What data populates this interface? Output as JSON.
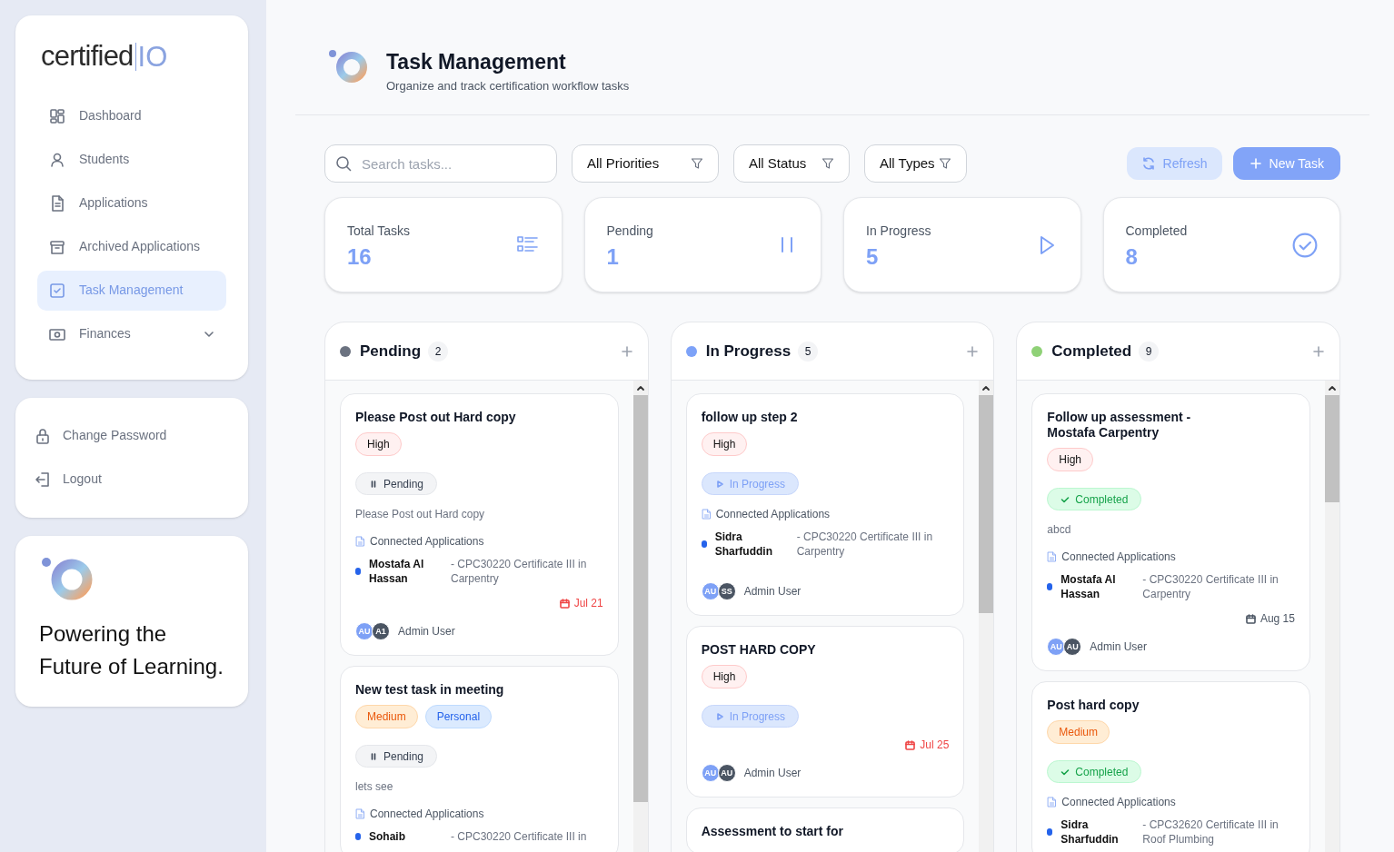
{
  "sidebar": {
    "logo": "certified",
    "logo_suffix": "IO",
    "nav": [
      {
        "label": "Dashboard",
        "selected": false
      },
      {
        "label": "Students",
        "selected": false
      },
      {
        "label": "Applications",
        "selected": false
      },
      {
        "label": "Archived Applications",
        "selected": false
      },
      {
        "label": "Task Management",
        "selected": true
      },
      {
        "label": "Finances",
        "selected": false,
        "expandable": true
      }
    ],
    "account": [
      {
        "label": "Change Password"
      },
      {
        "label": "Logout"
      }
    ],
    "tagline": "Powering the Future of Learning."
  },
  "header": {
    "title": "Task Management",
    "subtitle": "Organize and track certification workflow tasks"
  },
  "toolbar": {
    "search": {
      "placeholder": "Search tasks..."
    },
    "filters": [
      "All Priorities",
      "All Status",
      "All Types"
    ],
    "refresh": "Refresh",
    "new_task": "New Task"
  },
  "stats": [
    {
      "label": "Total Tasks",
      "value": "16"
    },
    {
      "label": "Pending",
      "value": "1"
    },
    {
      "label": "In Progress",
      "value": "5"
    },
    {
      "label": "Completed",
      "value": "8"
    }
  ],
  "columns": [
    {
      "title": "Pending",
      "count": "2",
      "color": "#6b7280",
      "cards": [
        {
          "title": "Please Post out Hard copy",
          "tags": [
            {
              "label": "High",
              "kind": "high"
            }
          ],
          "status": {
            "label": "Pending",
            "kind": "pending"
          },
          "description": "Please Post out Hard copy",
          "apps_label": "Connected Applications",
          "apps": [
            {
              "student": "Mostafa Al Hassan",
              "course": "- CPC30220 Certificate III in Carpentry"
            }
          ],
          "due": {
            "text": "Jul 21",
            "overdue": true
          },
          "avatars": [
            "AU",
            "A1"
          ],
          "assignee": "Admin User"
        },
        {
          "title": "New test task in meeting",
          "tags": [
            {
              "label": "Medium",
              "kind": "medium"
            },
            {
              "label": "Personal",
              "kind": "type"
            }
          ],
          "status": {
            "label": "Pending",
            "kind": "pending"
          },
          "description": "lets see",
          "apps_label": "Connected Applications",
          "apps": [
            {
              "student": "Sohaib",
              "course": "- CPC30220 Certificate III in"
            }
          ]
        }
      ]
    },
    {
      "title": "In Progress",
      "count": "5",
      "color": "#7da2f8",
      "cards": [
        {
          "title": "follow up step 2",
          "tags": [
            {
              "label": "High",
              "kind": "high"
            }
          ],
          "status": {
            "label": "In Progress",
            "kind": "progress"
          },
          "apps_label": "Connected Applications",
          "apps": [
            {
              "student": "Sidra Sharfuddin",
              "course": "- CPC30220 Certificate III in Carpentry"
            }
          ],
          "avatars": [
            "AU",
            "SS"
          ],
          "assignee": "Admin User"
        },
        {
          "title": "POST HARD COPY",
          "tags": [
            {
              "label": "High",
              "kind": "high"
            }
          ],
          "status": {
            "label": "In Progress",
            "kind": "progress"
          },
          "due": {
            "text": "Jul 25",
            "overdue": true
          },
          "avatars": [
            "AU",
            "AU"
          ],
          "assignee": "Admin User"
        },
        {
          "title": "Assessment to start for"
        }
      ]
    },
    {
      "title": "Completed",
      "count": "9",
      "color": "#8fd177",
      "cards": [
        {
          "title": "Follow up assessment - Mostafa Carpentry",
          "tags": [
            {
              "label": "High",
              "kind": "high"
            }
          ],
          "status": {
            "label": "Completed",
            "kind": "done"
          },
          "description": "abcd",
          "apps_label": "Connected Applications",
          "apps": [
            {
              "student": "Mostafa Al Hassan",
              "course": "- CPC30220 Certificate III in Carpentry"
            }
          ],
          "due": {
            "text": "Aug 15",
            "overdue": false
          },
          "avatars": [
            "AU",
            "AU"
          ],
          "assignee": "Admin User"
        },
        {
          "title": "Post hard copy",
          "tags": [
            {
              "label": "Medium",
              "kind": "medium"
            }
          ],
          "status": {
            "label": "Completed",
            "kind": "done"
          },
          "apps_label": "Connected Applications",
          "apps": [
            {
              "student": "Sidra Sharfuddin",
              "course": "- CPC32620 Certificate III in Roof Plumbing"
            }
          ]
        }
      ]
    }
  ]
}
